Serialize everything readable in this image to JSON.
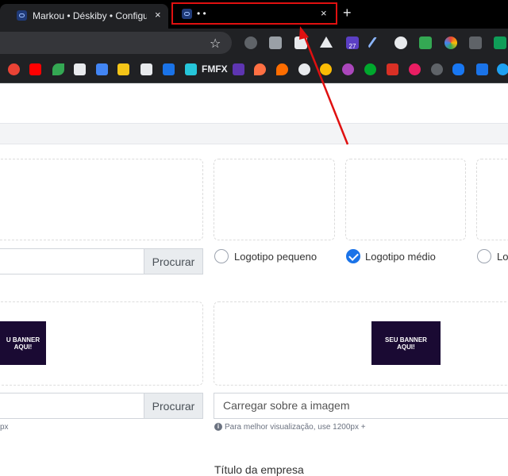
{
  "browser": {
    "tabs": [
      {
        "title": "Markou • Déskiby • Configuraçõ",
        "close": "×"
      },
      {
        "title": "• •",
        "close": "×"
      }
    ],
    "new_tab": "+",
    "star": "☆",
    "bookmark_label": "FMFX",
    "extension_badge": "27"
  },
  "colors": {
    "accent": "#1a73e8",
    "annotation": "#e01010",
    "banner_bg": "#1a0a33"
  },
  "logo_options": {
    "small": "Logotipo pequeno",
    "medium": "Logotipo médio",
    "large_partial": "Lo",
    "selected": "medium"
  },
  "upload": {
    "browse_label": "Procurar",
    "image_placeholder": "Carregar sobre a imagem",
    "hint": "Para melhor visualização, use 1200px +",
    "hint_left_partial": "px"
  },
  "banner": {
    "text_partial": "U BANNER AQUI!",
    "text_full": "SEU BANNER AQUI!"
  },
  "company": {
    "title_label": "Título da empresa"
  }
}
